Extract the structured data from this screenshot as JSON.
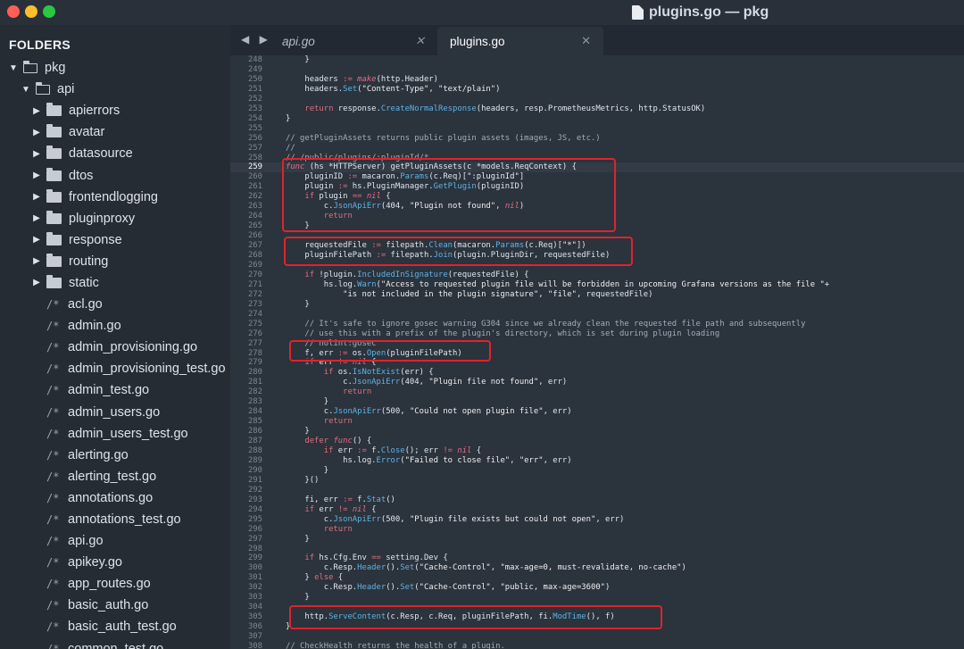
{
  "window": {
    "title": "plugins.go — pkg"
  },
  "sidebar": {
    "header": "FOLDERS",
    "items": [
      {
        "type": "folder-open",
        "depth": 0,
        "label": "pkg"
      },
      {
        "type": "folder-open",
        "depth": 1,
        "label": "api"
      },
      {
        "type": "folder",
        "depth": 2,
        "label": "apierrors"
      },
      {
        "type": "folder",
        "depth": 2,
        "label": "avatar"
      },
      {
        "type": "folder",
        "depth": 2,
        "label": "datasource"
      },
      {
        "type": "folder",
        "depth": 2,
        "label": "dtos"
      },
      {
        "type": "folder",
        "depth": 2,
        "label": "frontendlogging"
      },
      {
        "type": "folder",
        "depth": 2,
        "label": "pluginproxy"
      },
      {
        "type": "folder",
        "depth": 2,
        "label": "response"
      },
      {
        "type": "folder",
        "depth": 2,
        "label": "routing"
      },
      {
        "type": "folder",
        "depth": 2,
        "label": "static"
      },
      {
        "type": "file",
        "depth": 2,
        "label": "acl.go"
      },
      {
        "type": "file",
        "depth": 2,
        "label": "admin.go"
      },
      {
        "type": "file",
        "depth": 2,
        "label": "admin_provisioning.go"
      },
      {
        "type": "file",
        "depth": 2,
        "label": "admin_provisioning_test.go"
      },
      {
        "type": "file",
        "depth": 2,
        "label": "admin_test.go"
      },
      {
        "type": "file",
        "depth": 2,
        "label": "admin_users.go"
      },
      {
        "type": "file",
        "depth": 2,
        "label": "admin_users_test.go"
      },
      {
        "type": "file",
        "depth": 2,
        "label": "alerting.go"
      },
      {
        "type": "file",
        "depth": 2,
        "label": "alerting_test.go"
      },
      {
        "type": "file",
        "depth": 2,
        "label": "annotations.go"
      },
      {
        "type": "file",
        "depth": 2,
        "label": "annotations_test.go"
      },
      {
        "type": "file",
        "depth": 2,
        "label": "api.go"
      },
      {
        "type": "file",
        "depth": 2,
        "label": "apikey.go"
      },
      {
        "type": "file",
        "depth": 2,
        "label": "app_routes.go"
      },
      {
        "type": "file",
        "depth": 2,
        "label": "basic_auth.go"
      },
      {
        "type": "file",
        "depth": 2,
        "label": "basic_auth_test.go"
      },
      {
        "type": "file",
        "depth": 2,
        "label": "common_test.go"
      }
    ]
  },
  "tabs": {
    "nav": "◀ ▶",
    "items": [
      {
        "label": "api.go",
        "active": false,
        "close": "✕"
      },
      {
        "label": "plugins.go",
        "active": true,
        "close": "✕"
      }
    ]
  },
  "editor": {
    "current_line": "259",
    "lines": [
      {
        "n": "248",
        "t": "    }"
      },
      {
        "n": "249",
        "t": ""
      },
      {
        "n": "250",
        "t": "    headers := make(http.Header)"
      },
      {
        "n": "251",
        "t": "    headers.Set(\"Content-Type\", \"text/plain\")"
      },
      {
        "n": "252",
        "t": ""
      },
      {
        "n": "253",
        "t": "    return response.CreateNormalResponse(headers, resp.PrometheusMetrics, http.StatusOK)"
      },
      {
        "n": "254",
        "t": "}"
      },
      {
        "n": "255",
        "t": ""
      },
      {
        "n": "256",
        "t": "// getPluginAssets returns public plugin assets (images, JS, etc.)"
      },
      {
        "n": "257",
        "t": "//"
      },
      {
        "n": "258",
        "t": "// /public/plugins/:pluginId/*"
      },
      {
        "n": "259",
        "t": "func (hs *HTTPServer) getPluginAssets(c *models.ReqContext) {"
      },
      {
        "n": "260",
        "t": "    pluginID := macaron.Params(c.Req)[\":pluginId\"]"
      },
      {
        "n": "261",
        "t": "    plugin := hs.PluginManager.GetPlugin(pluginID)"
      },
      {
        "n": "262",
        "t": "    if plugin == nil {"
      },
      {
        "n": "263",
        "t": "        c.JsonApiErr(404, \"Plugin not found\", nil)"
      },
      {
        "n": "264",
        "t": "        return"
      },
      {
        "n": "265",
        "t": "    }"
      },
      {
        "n": "266",
        "t": ""
      },
      {
        "n": "267",
        "t": "    requestedFile := filepath.Clean(macaron.Params(c.Req)[\"*\"])"
      },
      {
        "n": "268",
        "t": "    pluginFilePath := filepath.Join(plugin.PluginDir, requestedFile)"
      },
      {
        "n": "269",
        "t": ""
      },
      {
        "n": "270",
        "t": "    if !plugin.IncludedInSignature(requestedFile) {"
      },
      {
        "n": "271",
        "t": "        hs.log.Warn(\"Access to requested plugin file will be forbidden in upcoming Grafana versions as the file \"+"
      },
      {
        "n": "272",
        "t": "            \"is not included in the plugin signature\", \"file\", requestedFile)"
      },
      {
        "n": "273",
        "t": "    }"
      },
      {
        "n": "274",
        "t": ""
      },
      {
        "n": "275",
        "t": "    // It's safe to ignore gosec warning G304 since we already clean the requested file path and subsequently"
      },
      {
        "n": "276",
        "t": "    // use this with a prefix of the plugin's directory, which is set during plugin loading"
      },
      {
        "n": "277",
        "t": "    // nolint:gosec"
      },
      {
        "n": "278",
        "t": "    f, err := os.Open(pluginFilePath)"
      },
      {
        "n": "279",
        "t": "    if err != nil {"
      },
      {
        "n": "280",
        "t": "        if os.IsNotExist(err) {"
      },
      {
        "n": "281",
        "t": "            c.JsonApiErr(404, \"Plugin file not found\", err)"
      },
      {
        "n": "282",
        "t": "            return"
      },
      {
        "n": "283",
        "t": "        }"
      },
      {
        "n": "284",
        "t": "        c.JsonApiErr(500, \"Could not open plugin file\", err)"
      },
      {
        "n": "285",
        "t": "        return"
      },
      {
        "n": "286",
        "t": "    }"
      },
      {
        "n": "287",
        "t": "    defer func() {"
      },
      {
        "n": "288",
        "t": "        if err := f.Close(); err != nil {"
      },
      {
        "n": "289",
        "t": "            hs.log.Error(\"Failed to close file\", \"err\", err)"
      },
      {
        "n": "290",
        "t": "        }"
      },
      {
        "n": "291",
        "t": "    }()"
      },
      {
        "n": "292",
        "t": ""
      },
      {
        "n": "293",
        "t": "    fi, err := f.Stat()"
      },
      {
        "n": "294",
        "t": "    if err != nil {"
      },
      {
        "n": "295",
        "t": "        c.JsonApiErr(500, \"Plugin file exists but could not open\", err)"
      },
      {
        "n": "296",
        "t": "        return"
      },
      {
        "n": "297",
        "t": "    }"
      },
      {
        "n": "298",
        "t": ""
      },
      {
        "n": "299",
        "t": "    if hs.Cfg.Env == setting.Dev {"
      },
      {
        "n": "300",
        "t": "        c.Resp.Header().Set(\"Cache-Control\", \"max-age=0, must-revalidate, no-cache\")"
      },
      {
        "n": "301",
        "t": "    } else {"
      },
      {
        "n": "302",
        "t": "        c.Resp.Header().Set(\"Cache-Control\", \"public, max-age=3600\")"
      },
      {
        "n": "303",
        "t": "    }"
      },
      {
        "n": "304",
        "t": ""
      },
      {
        "n": "305",
        "t": "    http.ServeContent(c.Resp, c.Req, pluginFilePath, fi.ModTime(), f)"
      },
      {
        "n": "306",
        "t": "}"
      },
      {
        "n": "307",
        "t": ""
      },
      {
        "n": "308",
        "t": "// CheckHealth returns the health of a plugin."
      }
    ]
  },
  "colors": {
    "highlight_box": "#e0232b",
    "keyword": "#df6f7c",
    "function": "#5fb3e3",
    "comment": "#a3adb8"
  }
}
